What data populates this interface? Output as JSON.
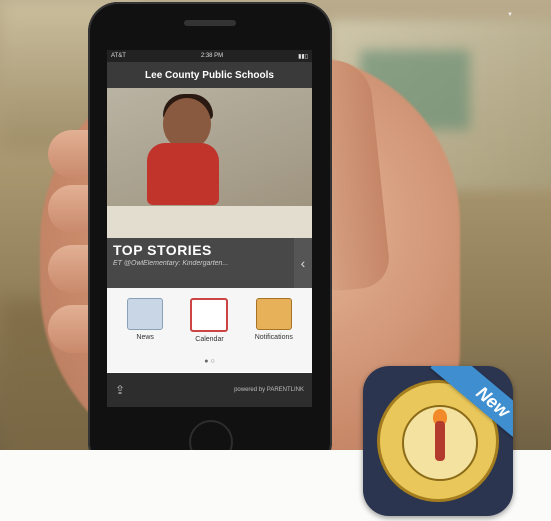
{
  "phone": {
    "status_carrier": "AT&T",
    "status_time": "2:38 PM",
    "app_title": "Lee County Public Schools",
    "top_stories_title": "TOP STORIES",
    "top_stories_subtitle": "ET @OwlElementary: Kindergarten...",
    "icons": [
      {
        "label": "News"
      },
      {
        "label": "Calendar"
      },
      {
        "label": "Notifications"
      }
    ],
    "powered_by": "powered by PARENTLINK"
  },
  "badge": {
    "ribbon": "New"
  }
}
